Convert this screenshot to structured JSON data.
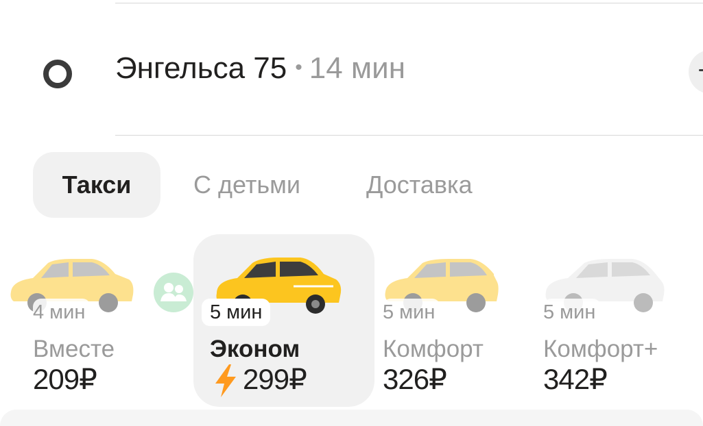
{
  "destination": {
    "address": "Энгельса 75",
    "separator": "•",
    "eta": "14 мин"
  },
  "tabs": [
    {
      "label": "Такси",
      "active": true
    },
    {
      "label": "С детьми",
      "active": false
    },
    {
      "label": "Доставка",
      "active": false
    }
  ],
  "tariffs": [
    {
      "name": "Вместе",
      "eta": "4 мин",
      "price": "209₽",
      "selected": false,
      "car_color": "yellow"
    },
    {
      "name": "Эконом",
      "eta": "5 мин",
      "price": "299₽",
      "selected": true,
      "surge": true,
      "car_color": "yellow"
    },
    {
      "name": "Комфорт",
      "eta": "5 мин",
      "price": "326₽",
      "selected": false,
      "car_color": "yellow"
    },
    {
      "name": "Комфорт+",
      "eta": "5 мин",
      "price": "342₽",
      "selected": false,
      "car_color": "white"
    }
  ],
  "colors": {
    "accent_yellow": "#fcc51f",
    "surge_orange": "#ff9a1f",
    "text_primary": "#21201f",
    "text_secondary": "#9a9a9a",
    "selected_bg": "#f1f1f1",
    "together_badge": "#c9ecd4"
  },
  "icons": {
    "destination": "ring-icon",
    "surge": "lightning-icon",
    "together": "people-icon"
  }
}
